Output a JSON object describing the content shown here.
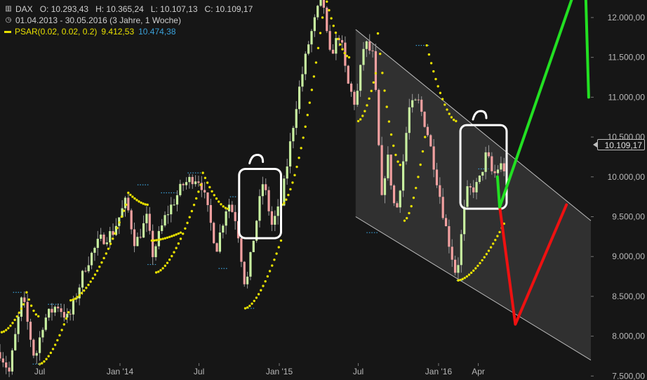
{
  "legend": {
    "instrument": "DAX",
    "ohlc": "O: 10.293,43   H: 10.365,24   L: 10.107,13   C: 10.109,17",
    "range": "01.04.2013 - 30.05.2016 (3 Jahre, 1 Woche)",
    "psar_label": "PSAR(0.02, 0.02, 0.2)",
    "psar_value_1": "9.412,53",
    "psar_value_2": "10.474,38",
    "icons": [
      "bar-chart-icon",
      "clock-icon",
      "psar-line-icon"
    ]
  },
  "price_tag": "10.109,17",
  "colors": {
    "background": "#161616",
    "up_candle": "#c8f0a0",
    "down_candle": "#f2a0a0",
    "psar": "#e8e000",
    "stop_line": "#3aa0d8",
    "arrow_green": "#22e022",
    "arrow_red": "#ee1111",
    "channel_fill": "#3a3a3a",
    "channel_line": "#bdbdbd",
    "markup": "#ffffff"
  },
  "chart_data": {
    "type": "candlestick",
    "title": "",
    "y_scale": "linear",
    "ylim": [
      7450,
      12220
    ],
    "y_ticks": [
      7500,
      8000,
      8500,
      9000,
      9500,
      10000,
      10500,
      11000,
      11500,
      12000
    ],
    "y_tick_labels": [
      "7.500,00",
      "8.000,00",
      "8.500,00",
      "9.000,00",
      "9.500,00",
      "10.000,00",
      "10.500,00",
      "11.000,00",
      "11.500,00",
      "12.000,00"
    ],
    "x_tick_labels": [
      "Jul",
      "Jan '14",
      "Jul",
      "Jan '15",
      "Jul",
      "Jan '16",
      "Apr"
    ],
    "x_tick_dates": [
      "2013-07-01",
      "2014-01-01",
      "2014-07-01",
      "2015-01-01",
      "2015-07-01",
      "2016-01-01",
      "2016-04-01"
    ],
    "xlim": [
      "2013-04-01",
      "2016-12-15"
    ],
    "close_path": [
      [
        "2013-04-01",
        7800
      ],
      [
        "2013-04-22",
        7550
      ],
      [
        "2013-05-22",
        8500
      ],
      [
        "2013-06-20",
        7700
      ],
      [
        "2013-07-10",
        8200
      ],
      [
        "2013-08-10",
        8400
      ],
      [
        "2013-09-05",
        8200
      ],
      [
        "2013-10-15",
        8900
      ],
      [
        "2013-11-15",
        9200
      ],
      [
        "2013-12-15",
        9300
      ],
      [
        "2014-01-15",
        9700
      ],
      [
        "2014-02-05",
        9150
      ],
      [
        "2014-03-05",
        9500
      ],
      [
        "2014-03-15",
        9000
      ],
      [
        "2014-04-15",
        9500
      ],
      [
        "2014-05-25",
        9900
      ],
      [
        "2014-06-20",
        10000
      ],
      [
        "2014-07-05",
        9950
      ],
      [
        "2014-08-10",
        9100
      ],
      [
        "2014-09-05",
        9700
      ],
      [
        "2014-09-25",
        9450
      ],
      [
        "2014-10-16",
        8580
      ],
      [
        "2014-11-05",
        9300
      ],
      [
        "2014-11-25",
        9950
      ],
      [
        "2014-12-15",
        9400
      ],
      [
        "2015-01-05",
        9650
      ],
      [
        "2015-02-10",
        10950
      ],
      [
        "2015-03-10",
        11700
      ],
      [
        "2015-04-10",
        12300
      ],
      [
        "2015-04-25",
        11500
      ],
      [
        "2015-05-20",
        11800
      ],
      [
        "2015-06-05",
        11200
      ],
      [
        "2015-06-25",
        10900
      ],
      [
        "2015-07-15",
        11700
      ],
      [
        "2015-08-05",
        11500
      ],
      [
        "2015-08-24",
        9700
      ],
      [
        "2015-09-05",
        10300
      ],
      [
        "2015-09-25",
        9500
      ],
      [
        "2015-10-10",
        10100
      ],
      [
        "2015-10-25",
        10850
      ],
      [
        "2015-11-15",
        10950
      ],
      [
        "2015-12-05",
        10600
      ],
      [
        "2015-12-20",
        10200
      ],
      [
        "2016-01-20",
        9300
      ],
      [
        "2016-02-11",
        8750
      ],
      [
        "2016-03-05",
        9800
      ],
      [
        "2016-04-01",
        9900
      ],
      [
        "2016-04-20",
        10300
      ],
      [
        "2016-05-05",
        10000
      ],
      [
        "2016-05-20",
        10150
      ],
      [
        "2016-05-30",
        10109
      ]
    ],
    "psar": {
      "name": "PSAR(0.02, 0.02, 0.2)",
      "segments": [
        {
          "side": "below",
          "from": [
            "2013-04-05",
            8050
          ],
          "to": [
            "2013-05-25",
            8400
          ]
        },
        {
          "side": "above",
          "from": [
            "2013-06-01",
            8550
          ],
          "to": [
            "2013-06-28",
            8250
          ]
        },
        {
          "side": "below",
          "from": [
            "2013-07-01",
            7650
          ],
          "to": [
            "2013-09-05",
            8300
          ]
        },
        {
          "side": "below",
          "from": [
            "2013-09-10",
            8450
          ],
          "to": [
            "2014-01-15",
            9650
          ]
        },
        {
          "side": "above",
          "from": [
            "2014-01-20",
            9800
          ],
          "to": [
            "2014-03-05",
            9650
          ]
        },
        {
          "side": "below",
          "from": [
            "2014-03-15",
            9200
          ],
          "to": [
            "2014-05-20",
            9300
          ]
        },
        {
          "side": "below",
          "from": [
            "2014-03-25",
            8800
          ],
          "to": [
            "2014-07-05",
            9900
          ]
        },
        {
          "side": "above",
          "from": [
            "2014-07-10",
            10050
          ],
          "to": [
            "2014-09-05",
            9600
          ]
        },
        {
          "side": "below",
          "from": [
            "2014-10-15",
            8350
          ],
          "to": [
            "2015-01-05",
            9200
          ]
        },
        {
          "side": "below",
          "from": [
            "2015-01-07",
            9650
          ],
          "to": [
            "2015-04-10",
            12000
          ]
        },
        {
          "side": "above",
          "from": [
            "2015-04-20",
            12200
          ],
          "to": [
            "2015-06-10",
            11500
          ]
        },
        {
          "side": "below",
          "from": [
            "2015-07-01",
            10700
          ],
          "to": [
            "2015-08-10",
            11300
          ]
        },
        {
          "side": "above",
          "from": [
            "2015-08-15",
            11800
          ],
          "to": [
            "2015-10-05",
            10150
          ]
        },
        {
          "side": "below",
          "from": [
            "2015-10-15",
            9450
          ],
          "to": [
            "2015-12-01",
            10500
          ]
        },
        {
          "side": "above",
          "from": [
            "2015-12-05",
            11650
          ],
          "to": [
            "2016-02-10",
            10700
          ]
        },
        {
          "side": "below",
          "from": [
            "2016-02-15",
            8700
          ],
          "to": [
            "2016-05-30",
            9412
          ]
        }
      ]
    },
    "stop_levels": [
      {
        "from": "2013-05-01",
        "to": "2013-05-20",
        "value": 8550
      },
      {
        "from": "2013-07-20",
        "to": "2013-08-20",
        "value": 8400
      },
      {
        "from": "2013-06-15",
        "to": "2013-07-05",
        "value": 7650
      },
      {
        "from": "2014-02-10",
        "to": "2014-03-10",
        "value": 9900
      },
      {
        "from": "2014-03-05",
        "to": "2014-03-25",
        "value": 8900
      },
      {
        "from": "2014-04-05",
        "to": "2014-05-10",
        "value": 9800
      },
      {
        "from": "2014-06-05",
        "to": "2014-07-05",
        "value": 10050
      },
      {
        "from": "2014-08-15",
        "to": "2014-09-05",
        "value": 8850
      },
      {
        "from": "2014-09-10",
        "to": "2014-09-25",
        "value": 9750
      },
      {
        "from": "2014-10-16",
        "to": "2014-11-05",
        "value": 8350
      },
      {
        "from": "2014-12-15",
        "to": "2014-12-30",
        "value": 10100
      },
      {
        "from": "2015-07-20",
        "to": "2015-08-15",
        "value": 9300
      },
      {
        "from": "2015-11-10",
        "to": "2015-12-10",
        "value": 11650
      },
      {
        "from": "2016-02-11",
        "to": "2016-02-28",
        "value": 8700
      },
      {
        "from": "2016-04-01",
        "to": "2016-04-25",
        "value": 10100
      }
    ],
    "channel": {
      "upper": [
        [
          "2015-06-25",
          11850
        ],
        [
          "2016-12-15",
          9450
        ]
      ],
      "lower": [
        [
          "2015-06-25",
          9500
        ],
        [
          "2016-12-15",
          7700
        ]
      ]
    },
    "forecast_green": [
      [
        "2016-05-15",
        10000
      ],
      [
        "2016-05-20",
        9620
      ],
      [
        "2016-12-01",
        12700
      ],
      [
        "2016-12-10",
        11000
      ]
    ],
    "forecast_red": [
      [
        "2016-05-20",
        9630
      ],
      [
        "2016-06-25",
        8150
      ],
      [
        "2016-10-20",
        9650
      ]
    ],
    "highlight_boxes": [
      {
        "from": "2014-10-01",
        "to": "2015-01-05",
        "top": 10100,
        "bottom": 9230
      },
      {
        "from": "2016-02-20",
        "to": "2016-06-05",
        "top": 10650,
        "bottom": 9600
      }
    ]
  }
}
